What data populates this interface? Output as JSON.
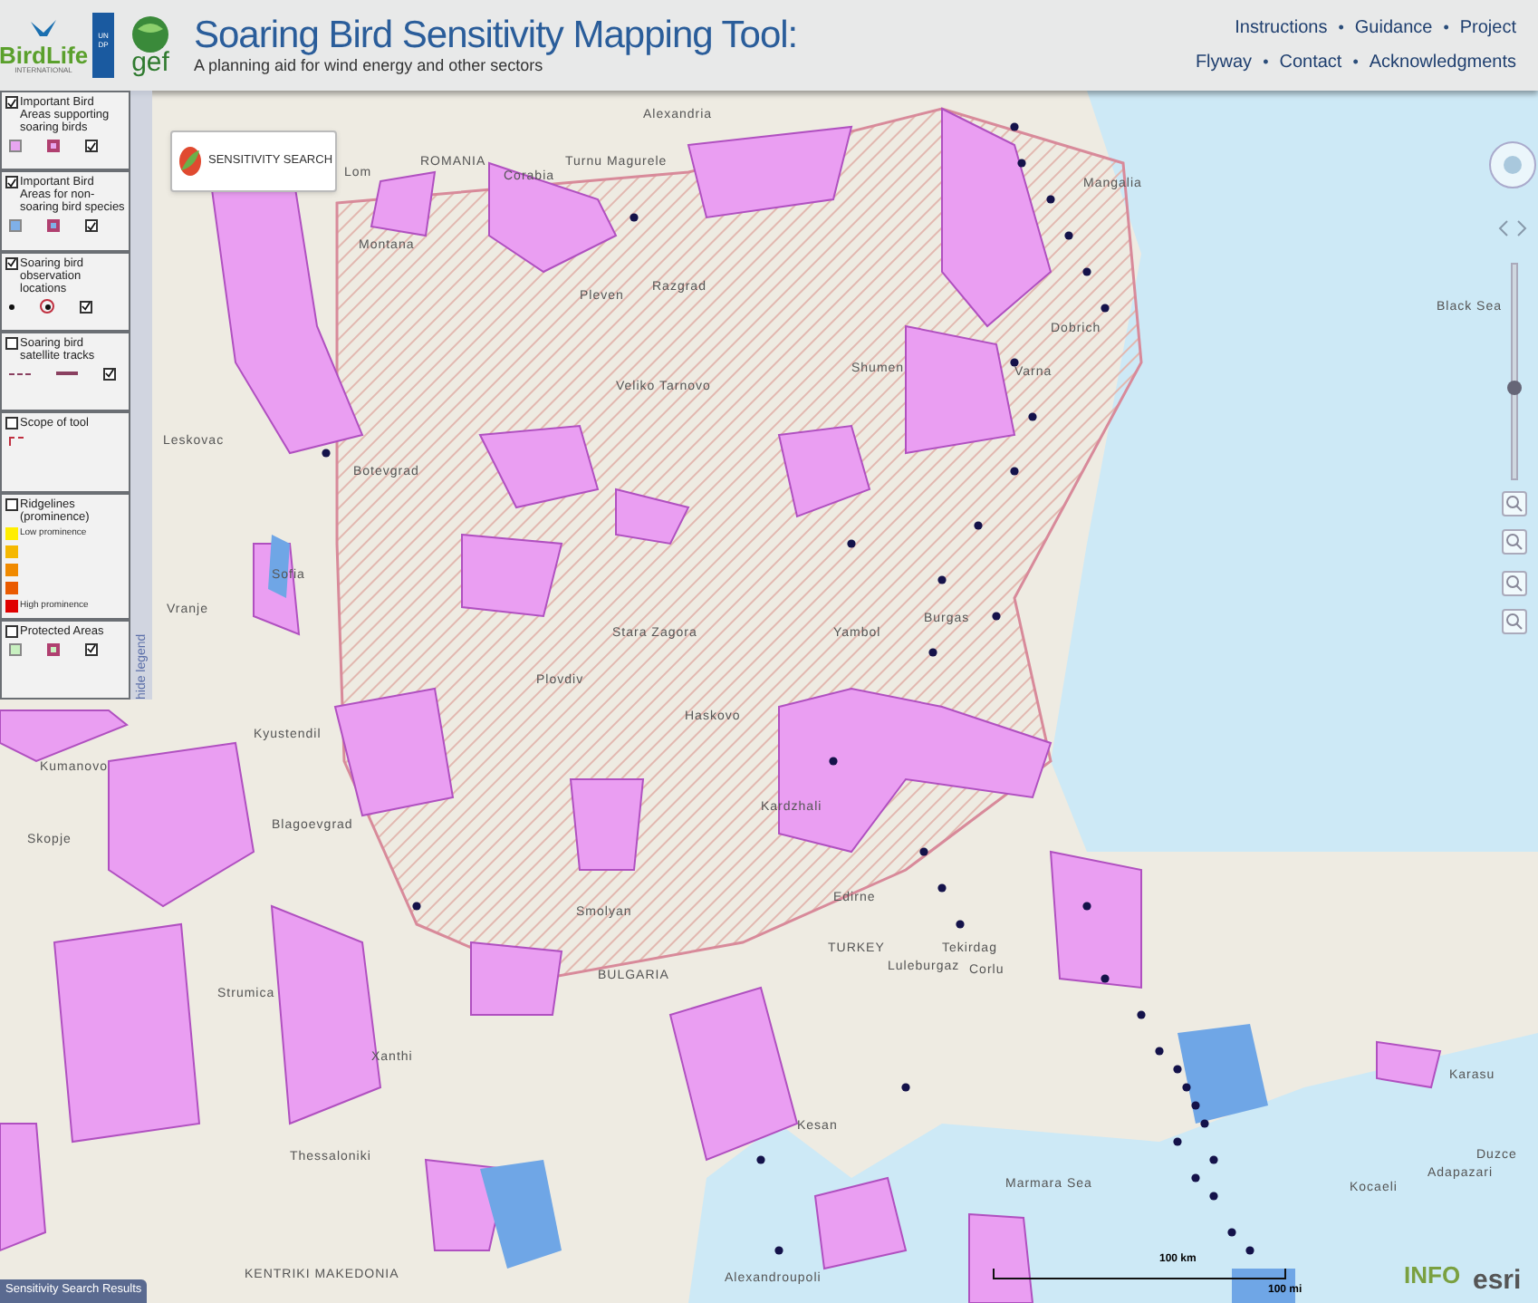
{
  "header": {
    "logos": {
      "birdlife": "BirdLife",
      "birdlife_sub": "INTERNATIONAL",
      "undp": "UN DP",
      "gef": "gef"
    },
    "title": "Soaring Bird Sensitivity Mapping Tool:",
    "subtitle": "A planning aid for wind energy and other sectors",
    "nav_rows": [
      [
        "Instructions",
        "Guidance",
        "Project"
      ],
      [
        "Flyway",
        "Contact",
        "Acknowledgments"
      ]
    ],
    "separator": "•"
  },
  "legend": {
    "hide_tab": "hide legend",
    "items": [
      {
        "label": "Important Bird Areas supporting soaring birds",
        "checked": true,
        "kind": "area",
        "color": "#e8a6f0",
        "sub_checked": true
      },
      {
        "label": "Important Bird Areas for non-soaring bird species",
        "checked": true,
        "kind": "area",
        "color": "#7fb0e8",
        "sub_checked": true
      },
      {
        "label": "Soaring bird observation locations",
        "checked": true,
        "kind": "dot",
        "sub_checked": true
      },
      {
        "label": "Soaring bird satellite tracks",
        "checked": false,
        "kind": "line",
        "sub_checked": true
      },
      {
        "label": "Scope of tool",
        "checked": false,
        "kind": "scope"
      },
      {
        "label": "Ridgelines (prominence)",
        "checked": false,
        "kind": "ramp",
        "ramp": [
          {
            "color": "#ffee00",
            "text": "Low prominence"
          },
          {
            "color": "#f5b800"
          },
          {
            "color": "#f08a00"
          },
          {
            "color": "#ea5a00"
          },
          {
            "color": "#e00000",
            "text": "High prominence"
          }
        ]
      },
      {
        "label": "Protected Areas",
        "checked": false,
        "kind": "area",
        "color": "#c8f0c0",
        "sub_checked": true
      }
    ]
  },
  "search_button": "SENSITIVITY SEARCH",
  "zoom": {
    "level": 0.43
  },
  "map_labels": [
    "Alexandria",
    "Lom",
    "ROMANIA",
    "Corabia",
    "Turnu Magurele",
    "Mangalia",
    "Dobrich",
    "Razgrad",
    "Pleven",
    "Montana",
    "Veliko Tarnovo",
    "Shumen",
    "Varna",
    "Black Sea",
    "Botevgrad",
    "Sofia",
    "Stara Zagora",
    "Yambol",
    "Burgas",
    "Plovdiv",
    "Haskovo",
    "Kyustendil",
    "Blagoevgrad",
    "Smolyan",
    "Kardzhali",
    "Skopje",
    "Kumanovo",
    "Leskovac",
    "Vranje",
    "Edirne",
    "TURKEY",
    "Luleburgaz",
    "Tekirdag",
    "Corlu",
    "Karasu",
    "Duzce",
    "Adapazari",
    "Kocaeli",
    "Xanthi",
    "Alexandroupoli",
    "Marmara Sea",
    "Thessaloniki",
    "KENTRIKI MAKEDONIA",
    "Kesan",
    "BULGARIA",
    "Strumica"
  ],
  "scale": {
    "km": "100 km",
    "mi": "100 mi"
  },
  "results_tab": "Sensitivity Search Results",
  "credits": {
    "info": "INFO",
    "esri": "esri"
  }
}
